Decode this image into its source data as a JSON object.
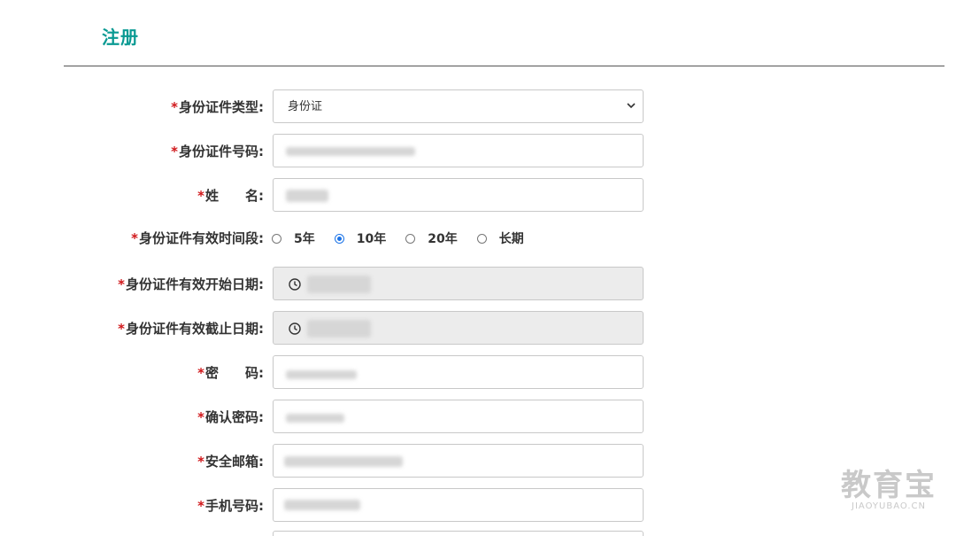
{
  "page": {
    "title": "注册"
  },
  "form": {
    "required_mark": "*",
    "id_type": {
      "label": "身份证件类型:",
      "value": "身份证"
    },
    "id_number": {
      "label": "身份证件号码:"
    },
    "name": {
      "label": "姓　　名:"
    },
    "validity_period": {
      "label": "身份证件有效时间段:",
      "options": [
        {
          "label": "5年",
          "checked": false
        },
        {
          "label": "10年",
          "checked": true
        },
        {
          "label": "20年",
          "checked": false
        },
        {
          "label": "长期",
          "checked": false
        }
      ]
    },
    "start_date": {
      "label": "身份证件有效开始日期:"
    },
    "end_date": {
      "label": "身份证件有效截止日期:"
    },
    "password": {
      "label": "密　　码:"
    },
    "confirm_password": {
      "label": "确认密码:"
    },
    "email": {
      "label": "安全邮箱:"
    },
    "phone": {
      "label": "手机号码:"
    }
  },
  "watermark": {
    "cn": "教育宝",
    "en": "JIAOYUBAO.CN"
  },
  "colors": {
    "title": "#0a9a93",
    "required": "#d0171a",
    "radio_checked": "#1a73e8"
  }
}
